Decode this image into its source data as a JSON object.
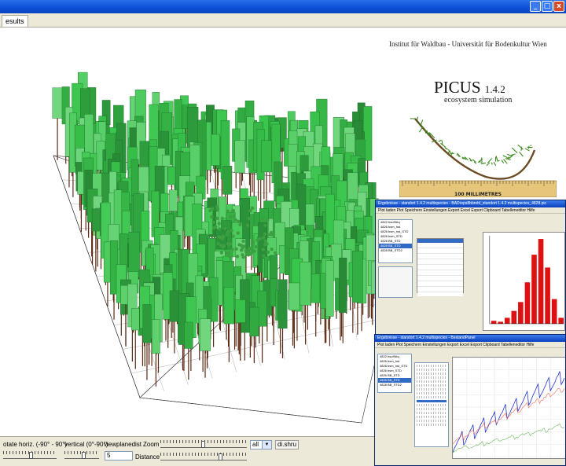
{
  "app": {
    "window_controls": {
      "minimize": "_",
      "maximize": "□",
      "close": "x"
    },
    "tab_label": "esults"
  },
  "controls": {
    "rotate_label": "otate horiz. (-90° - 90°)",
    "vertical_label": "vertical (0°-90°)",
    "viewplane_label": "viewplanedist",
    "viewplane_value": "5",
    "zoom_label": "Zoom",
    "distance_label": "Distance",
    "filter_value": "all",
    "filter_button": "di.shru"
  },
  "splash": {
    "institute": "Institut für Waldbau - Universität für Bodenkultur Wien",
    "product": "PICUS",
    "version": "1.4.2",
    "tagline": "ecosystem simulation",
    "ruler_label": "100 MILLIMETRES"
  },
  "histogram_window": {
    "title": "Ergebnisse - standort 1.4.2 multispecies - BADreps8bbrebl_standort 1.4.2 multispecies_4828.pic",
    "menu": "Plot laden   Plot Speichern   Einstellungen   Export Excel   Export Clipboard   Tabelleneditor   Hilfe",
    "list_items": [
      "4822 bsuf9Aq",
      "4826 bsm_hst",
      "4826 bsm_hst_STD",
      "4826 bsm_STD",
      "4826 BB_STD",
      "4828 BB_STD",
      "4828 BB_STD2"
    ],
    "selected_index": 5,
    "chart_data": {
      "type": "bar",
      "values": [
        1.5,
        1,
        3,
        6.5,
        11,
        21,
        35,
        43,
        28.5,
        12.5,
        3
      ],
      "color": "#dd1111"
    }
  },
  "timeseries_window": {
    "title": "Ergebnisse - standort 1.4.2 multispecies - BestandPanel",
    "menu": "Plot laden   Plot Speichern   Einstellungen   Export Excel   Export Clipboard   Tabelleneditor   Hilfe",
    "list_items": [
      "4822 bsuf9Aq",
      "4826 bsm_hst",
      "4826 bsm_hst_STD",
      "4826 bsm_STD",
      "4826 BB_STD",
      "4828 BB_STD",
      "4828 BB_STD2"
    ],
    "selected_index": 5
  },
  "colors": {
    "foliage": "#2e9e3e",
    "trunk": "#5a2a14",
    "accent": "#0b4fd6"
  }
}
